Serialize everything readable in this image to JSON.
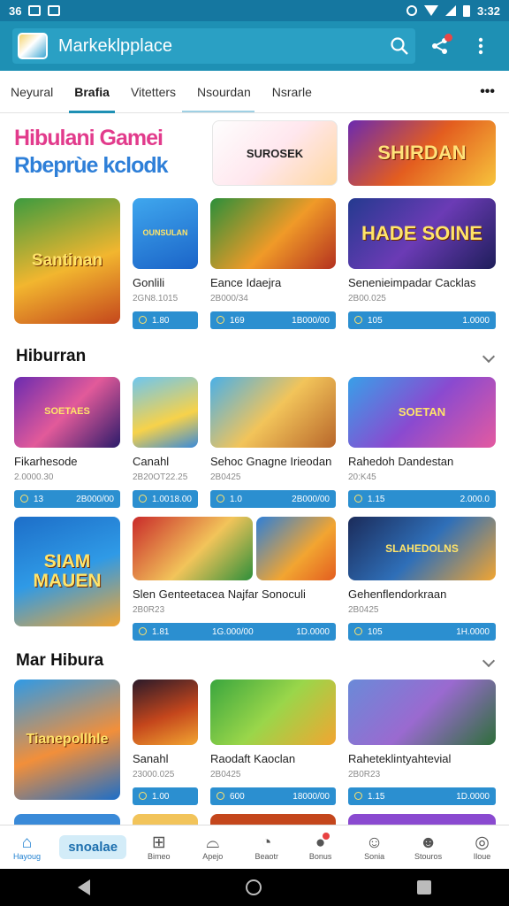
{
  "status_bar": {
    "left_text": "36",
    "time": "3:32"
  },
  "app_bar": {
    "title": "Markeklpplace"
  },
  "tabs": [
    {
      "label": "Neyural",
      "active": false
    },
    {
      "label": "Brafia",
      "active": true
    },
    {
      "label": "Vitetters",
      "active": false
    },
    {
      "label": "Nsourdan",
      "active": false
    },
    {
      "label": "Nsrarle",
      "active": false
    }
  ],
  "banner": {
    "line1": "Hibulani Gamei",
    "line2": "Rbeprùe kclodk",
    "img1_text": "SUROSEK",
    "img2_text": "SHIRDAN"
  },
  "featured": [
    {
      "thumb": "Santinan",
      "name": "",
      "sub": "",
      "price_left": "",
      "price_right": ""
    },
    {
      "thumb": "OUNSULAN",
      "name": "Gonlili",
      "sub": "2GN8.1015",
      "price_left": "1.80",
      "price_right": ""
    },
    {
      "thumb": "",
      "name": "Eance Idaejra",
      "sub": "2B000/34",
      "price_left": "169",
      "price_right": "1B000/00"
    },
    {
      "thumb": "HADE SOINE",
      "name": "Senenieimpadar Cacklas",
      "sub": "2B00.025",
      "price_left": "105",
      "price_right": "1.0000"
    }
  ],
  "section1": {
    "title": "Hiburran"
  },
  "row2": [
    {
      "thumb": "SOETAES",
      "name": "Fikarhesode",
      "sub": "2.0000.30",
      "price_left": "13",
      "price_right": "2B000/00"
    },
    {
      "thumb": "",
      "name": "Canahl",
      "sub": "2B20OT22.25",
      "price_left": "1.00",
      "price_right": "18.00"
    },
    {
      "thumb": "",
      "name": "Sehoc Gnagne Irieodan",
      "sub": "2B0425",
      "price_left": "1.0",
      "price_right": "2B000/00"
    },
    {
      "thumb": "SOETAN",
      "name": "Rahedoh Dandestan",
      "sub": "20:K45",
      "price_left": "1.15",
      "price_right": "2.000.0"
    }
  ],
  "row3": [
    {
      "thumb": "SIAM MAUEN",
      "name": "",
      "sub": "",
      "price_left": "",
      "price_right": ""
    },
    {
      "thumb": "",
      "name": "Slen Genteetacea Najfar Sonoculi",
      "sub": "2B0R23",
      "price_left": "1.81",
      "price_right": "1G.000/00"
    },
    {
      "thumb": "",
      "name": "",
      "sub": "",
      "price_left": "",
      "price_right": "1D.0000"
    },
    {
      "thumb": "SLAHEDOLNS",
      "name": "Gehenflendorkraan",
      "sub": "2B0425",
      "price_left": "105",
      "price_right": "1H.0000"
    }
  ],
  "section2": {
    "title": "Mar Hibura"
  },
  "row4": [
    {
      "thumb": "Tianepollhle",
      "name": "",
      "sub": "",
      "price_left": "",
      "price_right": ""
    },
    {
      "thumb": "",
      "name": "Sanahl",
      "sub": "23000.025",
      "price_left": "1.00",
      "price_right": ""
    },
    {
      "thumb": "",
      "name": "Raodaft Kaoclan",
      "sub": "2B0425",
      "price_left": "600",
      "price_right": "18000/00"
    },
    {
      "thumb": "",
      "name": "Raheteklintyahtevial",
      "sub": "2B0R23",
      "price_left": "1.15",
      "price_right": "1D.0000"
    }
  ],
  "bottom_nav": [
    {
      "label": "Hayoug",
      "active": true
    },
    {
      "label": "snoalae",
      "active": false,
      "search": true
    },
    {
      "label": "Bimeo",
      "active": false
    },
    {
      "label": "Apejo",
      "active": false
    },
    {
      "label": "Beaotr",
      "active": false
    },
    {
      "label": "Bonus",
      "active": false
    },
    {
      "label": "Sonia",
      "active": false
    },
    {
      "label": "Stouros",
      "active": false
    },
    {
      "label": "Iloue",
      "active": false
    }
  ]
}
